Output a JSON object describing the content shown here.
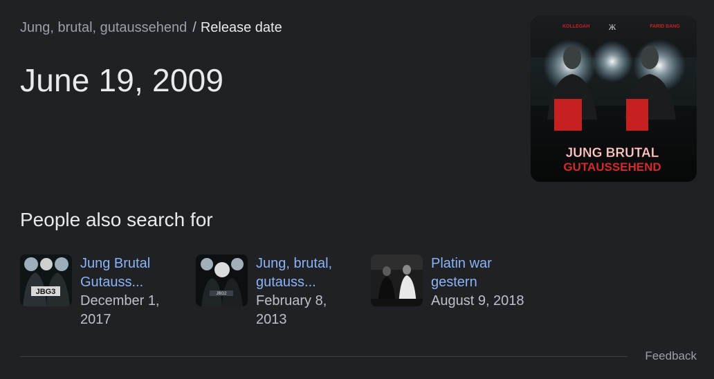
{
  "breadcrumb": {
    "parent": "Jung, brutal, gutaussehend",
    "separator": "/",
    "current": "Release date"
  },
  "answer": "June 19, 2009",
  "cover": {
    "left_artist": "KOLLEGAH",
    "right_artist": "FARID BANG",
    "title_line1": "JUNG BRUTAL",
    "title_line2": "GUTAUSSEHEND"
  },
  "people_also_search": {
    "title": "People also search for",
    "items": [
      {
        "name": "Jung Brutal Gutauss...",
        "date": "December 1, 2017",
        "thumb_text": "JBG3"
      },
      {
        "name": "Jung, brutal, gutauss...",
        "date": "February 8, 2013",
        "thumb_text": "JBG2"
      },
      {
        "name": "Platin war gestern",
        "date": "August 9, 2018",
        "thumb_text": ""
      }
    ]
  },
  "feedback_label": "Feedback",
  "colors": {
    "background": "#202124",
    "text_primary": "#e8eaed",
    "text_secondary": "#9aa0a6",
    "link": "#8ab4f8",
    "divider": "#3c4043",
    "cover_red": "#c62020"
  }
}
